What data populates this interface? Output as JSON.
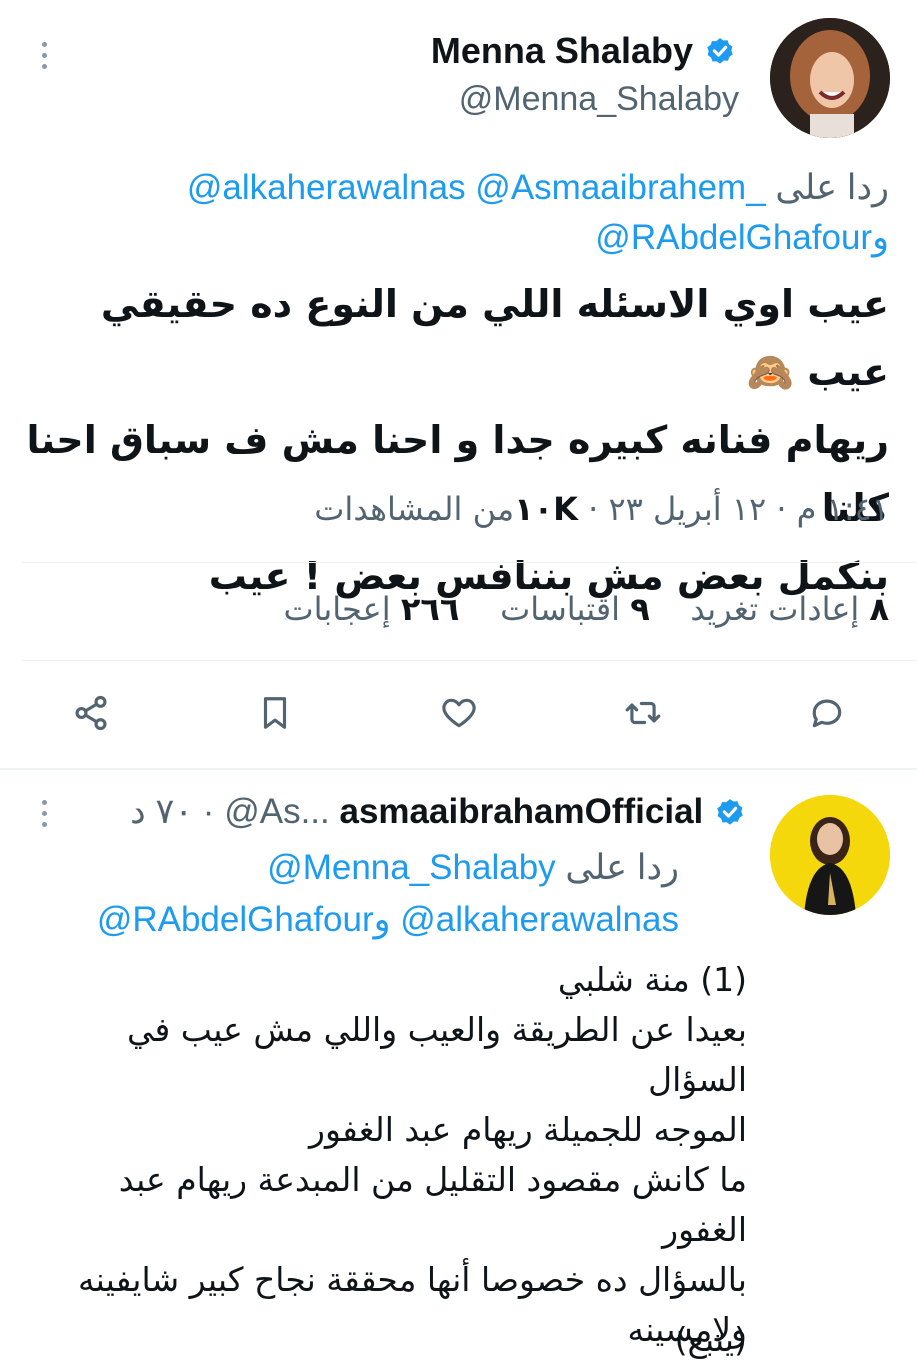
{
  "tweet": {
    "author_name": "Menna Shalaby",
    "handle": "@Menna_Shalaby",
    "reply_prefix": "ردا على",
    "reply_to_line1": "@alkaherawalnas @Asmaaibrahem_",
    "reply_to_conj": "و",
    "reply_to_line2": "@RAbdelGhafour",
    "body_lines": [
      "عيب اوي الاسئله اللي من النوع ده حقيقي عيب 🙈",
      "ريهام فنانه كبيره جدا و احنا مش ف سباق احنا كلنا",
      "بنكمل بعض مش بننافس بعض ! عيب"
    ],
    "timestamp": "١:٤١ م · ١٢ أبريل ٢٣ ·",
    "views_count": "١٠K",
    "views_label": "من المشاهدات",
    "stats": {
      "retweets_count": "٨",
      "retweets_label": "إعادات تغريد",
      "quotes_count": "٩",
      "quotes_label": "اقتباسات",
      "likes_count": "٢٦٦",
      "likes_label": "إعجابات"
    },
    "actions": [
      "reply-icon",
      "retweet-icon",
      "like-icon",
      "bookmark-icon",
      "share-icon"
    ],
    "verified_color": "#1d9bf0",
    "link_color": "#1d9bf0"
  },
  "reply": {
    "author_name": "asmaaibrahamOfficial",
    "handle_truncated": "@As...",
    "time_ago": "· ٧٠ د",
    "reply_prefix": "ردا على",
    "reply_to_line1": "@Menna_Shalaby",
    "reply_to_line2": "@alkaherawalnas",
    "reply_to_conj": "و",
    "reply_to_line2b": "@RAbdelGhafour",
    "body_lines": [
      "(1) منة شلبي",
      "بعيدا عن الطريقة والعيب واللي مش عيب في السؤال",
      "الموجه للجميلة ريهام عبد الغفور",
      "ما كانش مقصود التقليل من المبدعة ريهام عبد الغفور",
      "بالسؤال ده خصوصا أنها محققة نجاح كبير شايفينه",
      "ولامسينه"
    ],
    "continued": "(يتبع)"
  }
}
